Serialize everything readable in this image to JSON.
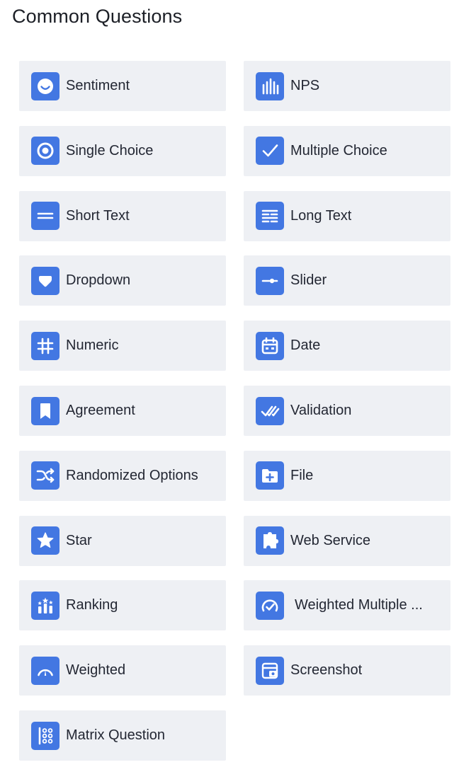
{
  "title": "Common Questions",
  "colors": {
    "accent": "#4377e2",
    "card_bg": "#eef0f4"
  },
  "items": [
    {
      "label": "Sentiment",
      "icon": "smiley-icon"
    },
    {
      "label": "NPS",
      "icon": "bars-icon"
    },
    {
      "label": "Single Choice",
      "icon": "radio-icon"
    },
    {
      "label": "Multiple Choice",
      "icon": "checkmark-icon"
    },
    {
      "label": "Short Text",
      "icon": "short-text-icon"
    },
    {
      "label": "Long Text",
      "icon": "long-text-icon"
    },
    {
      "label": "Dropdown",
      "icon": "dropdown-icon"
    },
    {
      "label": "Slider",
      "icon": "slider-icon"
    },
    {
      "label": "Numeric",
      "icon": "hash-icon"
    },
    {
      "label": "Date",
      "icon": "calendar-icon"
    },
    {
      "label": "Agreement",
      "icon": "bookmark-icon"
    },
    {
      "label": "Validation",
      "icon": "double-check-icon"
    },
    {
      "label": "Randomized Options",
      "icon": "shuffle-icon"
    },
    {
      "label": "File",
      "icon": "folder-plus-icon"
    },
    {
      "label": "Star",
      "icon": "star-icon"
    },
    {
      "label": "Web Service",
      "icon": "puzzle-icon"
    },
    {
      "label": "Ranking",
      "icon": "ranking-icon"
    },
    {
      "label": "Weighted Multiple ...",
      "icon": "gauge-check-icon"
    },
    {
      "label": "Weighted",
      "icon": "gauge-icon"
    },
    {
      "label": "Screenshot",
      "icon": "screenshot-icon"
    },
    {
      "label": "Matrix Question",
      "icon": "matrix-icon"
    }
  ]
}
